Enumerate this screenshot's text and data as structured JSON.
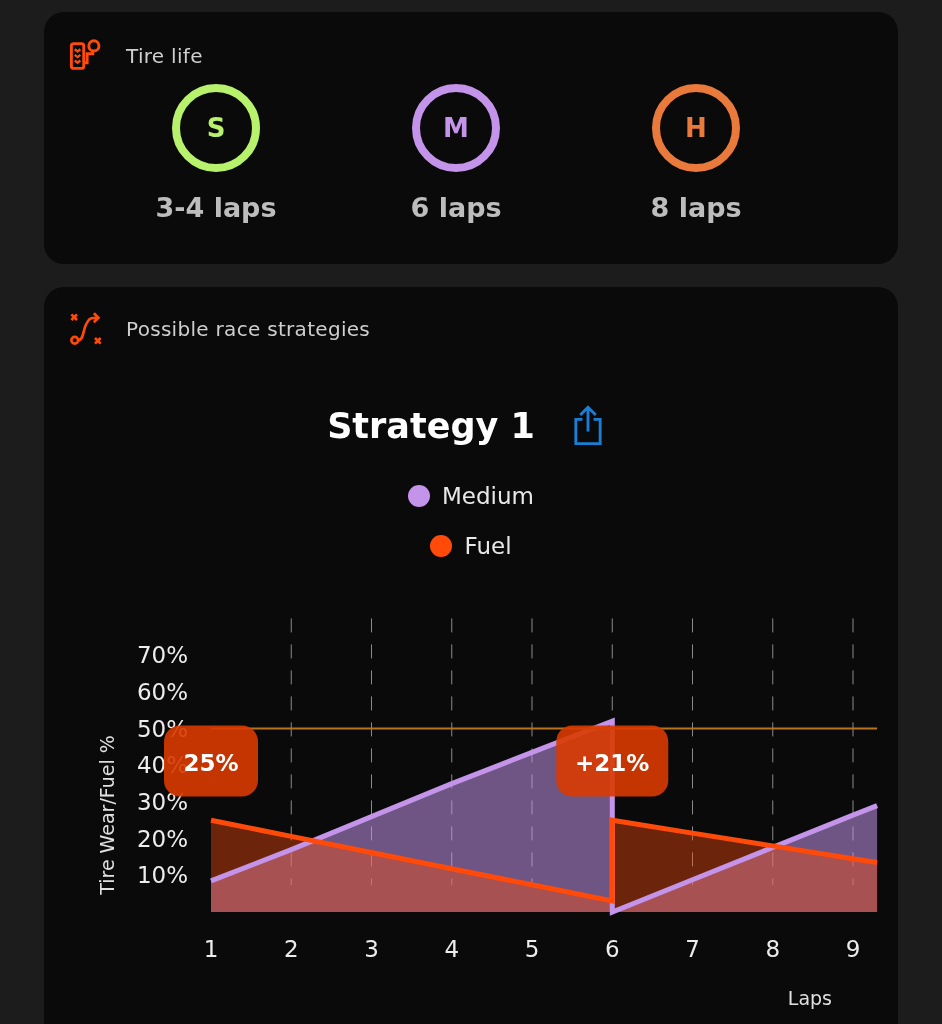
{
  "tire_life": {
    "title": "Tire life",
    "compounds": [
      {
        "letter": "S",
        "laps": "3-4 laps",
        "color": "#b8f26c"
      },
      {
        "letter": "M",
        "laps": "6 laps",
        "color": "#c394ea"
      },
      {
        "letter": "H",
        "laps": "8 laps",
        "color": "#ea7a3c"
      }
    ]
  },
  "strategies": {
    "title": "Possible race strategies",
    "strategy_title": "Strategy 1",
    "chart_data": {
      "type": "area",
      "xlabel": "Laps",
      "ylabel": "Tire Wear/Fuel %",
      "x": [
        1,
        2,
        3,
        4,
        5,
        6,
        6,
        7,
        8,
        9,
        9.3
      ],
      "series": [
        {
          "name": "Medium",
          "color": "#c394ea",
          "values": [
            8.5,
            17,
            26,
            35,
            43.5,
            52,
            0,
            8.8,
            17.6,
            26.4,
            29
          ]
        },
        {
          "name": "Fuel",
          "color": "#ff4a0a",
          "values": [
            25,
            20.6,
            16.2,
            11.8,
            7.4,
            3,
            25,
            21.5,
            18,
            14.5,
            13.5
          ]
        }
      ],
      "xlim": [
        1,
        9.3
      ],
      "ylim": [
        0,
        80
      ],
      "grid": true,
      "xticks": [
        1,
        2,
        3,
        4,
        5,
        6,
        7,
        8,
        9
      ],
      "yticks": [
        {
          "value": 10,
          "label": "10%"
        },
        {
          "value": 20,
          "label": "20%"
        },
        {
          "value": 30,
          "label": "30%"
        },
        {
          "value": 40,
          "label": "40%"
        },
        {
          "value": 50,
          "label": "50%"
        },
        {
          "value": 60,
          "label": "60%"
        },
        {
          "value": 70,
          "label": "70%"
        }
      ],
      "ref_lines": [
        {
          "axis": "y",
          "value": 50,
          "color": "#b8741a"
        }
      ],
      "annotations": [
        "25%",
        "+21%"
      ]
    }
  }
}
